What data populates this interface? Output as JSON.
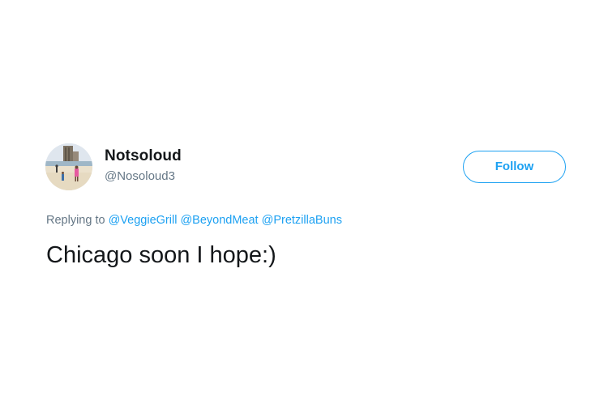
{
  "user": {
    "display_name": "Notsoloud",
    "handle": "@Nosoloud3",
    "avatar_icon": "beach-photo-avatar"
  },
  "follow_button": {
    "label": "Follow"
  },
  "reply": {
    "prefix": "Replying to",
    "mentions": [
      "@VeggieGrill",
      "@BeyondMeat",
      "@PretzillaBuns"
    ]
  },
  "tweet": {
    "text": "Chicago soon I hope:)"
  },
  "colors": {
    "accent": "#1da1f2",
    "text_primary": "#14171a",
    "text_secondary": "#657786",
    "background": "#ffffff"
  }
}
